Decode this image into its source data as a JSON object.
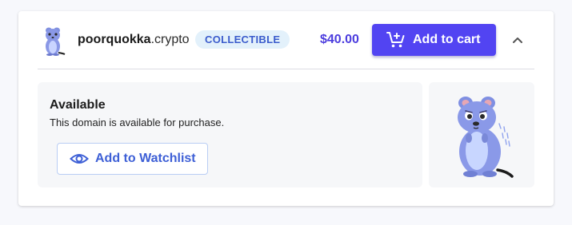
{
  "listing": {
    "domain_name": "poorquokka",
    "domain_tld": ".crypto",
    "badge": "COLLECTIBLE",
    "price": "$40.00",
    "add_to_cart_label": "Add to cart",
    "status_title": "Available",
    "status_description": "This domain is available for purchase.",
    "watchlist_label": "Add to Watchlist"
  },
  "icons": {
    "cart": "cart-plus-icon",
    "collapse": "chevron-up-icon",
    "watch": "eye-icon",
    "avatar": "quokka-nft-image"
  },
  "colors": {
    "primary_button": "#5244f2",
    "price": "#4c3dde",
    "badge_bg": "#e3f1fb",
    "badge_text": "#3b5ccc",
    "link_blue": "#3d5fd6",
    "panel_bg": "#f6f7f9"
  }
}
